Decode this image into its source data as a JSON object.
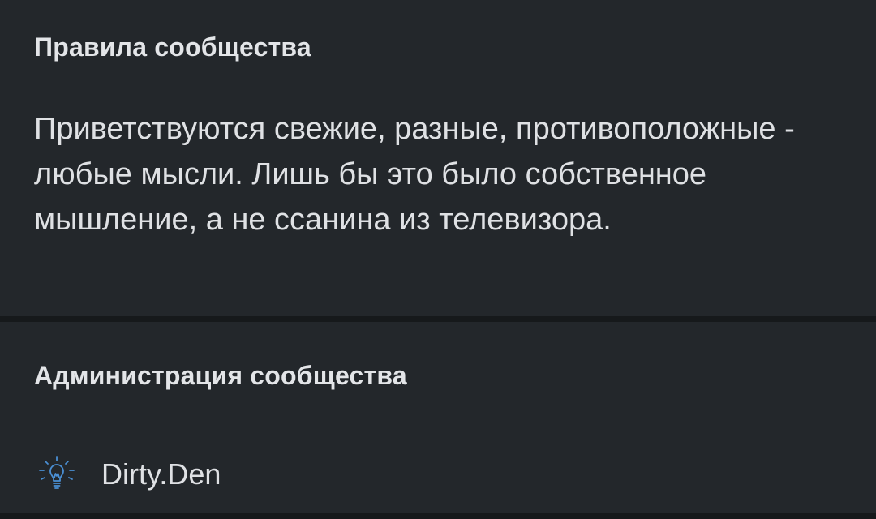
{
  "rules": {
    "title": "Правила сообщества",
    "text": "Приветствуются свежие, разные, противоположные - любые мысли. Лишь бы это было собственное мышление, а не ссанина из телевизора."
  },
  "admin": {
    "title": "Администрация сообщества",
    "members": [
      {
        "name": "Dirty.Den",
        "icon": "lightbulb-icon",
        "icon_color": "#4a8fd4"
      }
    ]
  },
  "colors": {
    "background": "#23272b",
    "separator": "#16191b",
    "text": "#dfe1e4",
    "accent": "#4a8fd4"
  }
}
